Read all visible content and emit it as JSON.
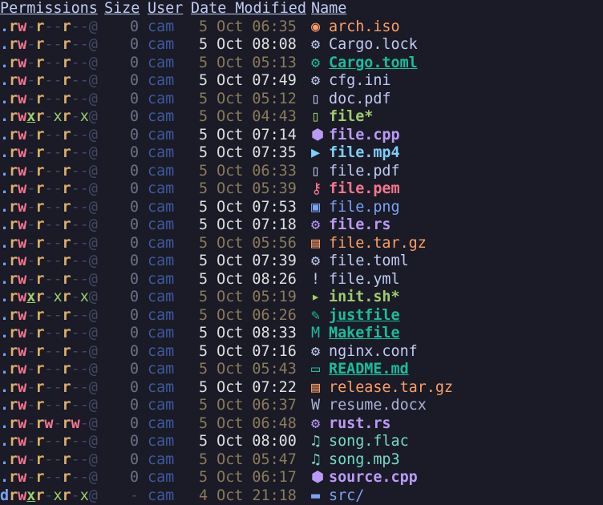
{
  "header": {
    "permissions": "Permissions",
    "size": "Size",
    "user": "User",
    "date": "Date Modified",
    "name": "Name"
  },
  "colors": {
    "background": "#1a1b26",
    "foreground": "#c0caf5",
    "perm_read": "#e0af68",
    "perm_write": "#f7768e",
    "perm_exec": "#9ece6a",
    "perm_dash": "#414868",
    "perm_dot": "#7aa2f7",
    "user": "#3d59a1",
    "date_recent": "#e0e0e0",
    "date_old": "#8c7a5a",
    "size": "#6c7086"
  },
  "files": [
    {
      "perms": ".rw-r--r--@",
      "size": "0",
      "user": "cam",
      "date": "5 Oct 06:35",
      "recent": false,
      "icon": "disc-icon",
      "glyph": "◉",
      "name": "arch.iso",
      "color": "#ff9e64",
      "bold": false,
      "underline": false
    },
    {
      "perms": ".rw-r--r--@",
      "size": "0",
      "user": "cam",
      "date": "5 Oct 08:08",
      "recent": true,
      "icon": "rust-gear-icon",
      "glyph": "⚙",
      "name": "Cargo.lock",
      "color": "#c0caf5",
      "bold": false,
      "underline": false
    },
    {
      "perms": ".rw-r--r--@",
      "size": "0",
      "user": "cam",
      "date": "5 Oct 05:13",
      "recent": false,
      "icon": "rust-gear-icon",
      "glyph": "⚙",
      "name": "Cargo.toml",
      "color": "#1abc9c",
      "bold": true,
      "underline": true
    },
    {
      "perms": ".rw-r--r--@",
      "size": "0",
      "user": "cam",
      "date": "5 Oct 07:49",
      "recent": true,
      "icon": "gear-icon",
      "glyph": "⚙",
      "name": "cfg.ini",
      "color": "#c0caf5",
      "bold": false,
      "underline": false
    },
    {
      "perms": ".rw-r--r--@",
      "size": "0",
      "user": "cam",
      "date": "5 Oct 05:12",
      "recent": false,
      "icon": "pdf-icon",
      "glyph": "▯",
      "name": "doc.pdf",
      "color": "#c0caf5",
      "bold": false,
      "underline": false
    },
    {
      "perms": ".rwxr-xr-x@",
      "size": "0",
      "user": "cam",
      "date": "5 Oct 04:43",
      "recent": false,
      "icon": "file-icon",
      "glyph": "▯",
      "name": "file*",
      "color": "#9ece6a",
      "bold": true,
      "underline": false
    },
    {
      "perms": ".rw-r--r--@",
      "size": "0",
      "user": "cam",
      "date": "5 Oct 07:14",
      "recent": true,
      "icon": "cpp-icon",
      "glyph": "⬢",
      "name": "file.cpp",
      "color": "#bb9af7",
      "bold": true,
      "underline": false
    },
    {
      "perms": ".rw-r--r--@",
      "size": "0",
      "user": "cam",
      "date": "5 Oct 07:35",
      "recent": true,
      "icon": "video-icon",
      "glyph": "▶",
      "name": "file.mp4",
      "color": "#7dcfff",
      "bold": true,
      "underline": false
    },
    {
      "perms": ".rw-r--r--@",
      "size": "0",
      "user": "cam",
      "date": "5 Oct 06:33",
      "recent": false,
      "icon": "pdf-icon",
      "glyph": "▯",
      "name": "file.pdf",
      "color": "#c0caf5",
      "bold": false,
      "underline": false
    },
    {
      "perms": ".rw-r--r--@",
      "size": "0",
      "user": "cam",
      "date": "5 Oct 05:39",
      "recent": false,
      "icon": "key-icon",
      "glyph": "⚷",
      "name": "file.pem",
      "color": "#f7768e",
      "bold": true,
      "underline": false
    },
    {
      "perms": ".rw-r--r--@",
      "size": "0",
      "user": "cam",
      "date": "5 Oct 07:53",
      "recent": true,
      "icon": "image-icon",
      "glyph": "▣",
      "name": "file.png",
      "color": "#7aa2f7",
      "bold": false,
      "underline": false
    },
    {
      "perms": ".rw-r--r--@",
      "size": "0",
      "user": "cam",
      "date": "5 Oct 07:18",
      "recent": true,
      "icon": "rust-icon",
      "glyph": "⚙",
      "name": "file.rs",
      "color": "#bb9af7",
      "bold": true,
      "underline": false
    },
    {
      "perms": ".rw-r--r--@",
      "size": "0",
      "user": "cam",
      "date": "5 Oct 05:56",
      "recent": false,
      "icon": "archive-icon",
      "glyph": "▤",
      "name": "file.tar.gz",
      "color": "#ff9e64",
      "bold": false,
      "underline": false
    },
    {
      "perms": ".rw-r--r--@",
      "size": "0",
      "user": "cam",
      "date": "5 Oct 07:39",
      "recent": true,
      "icon": "gear-icon",
      "glyph": "⚙",
      "name": "file.toml",
      "color": "#c0caf5",
      "bold": false,
      "underline": false
    },
    {
      "perms": ".rw-r--r--@",
      "size": "0",
      "user": "cam",
      "date": "5 Oct 08:26",
      "recent": true,
      "icon": "exclamation-icon",
      "glyph": "!",
      "name": "file.yml",
      "color": "#c0caf5",
      "bold": false,
      "underline": false
    },
    {
      "perms": ".rwxr-xr-x@",
      "size": "0",
      "user": "cam",
      "date": "5 Oct 05:19",
      "recent": false,
      "icon": "terminal-icon",
      "glyph": "▸",
      "name": "init.sh*",
      "color": "#9ece6a",
      "bold": true,
      "underline": false
    },
    {
      "perms": ".rw-r--r--@",
      "size": "0",
      "user": "cam",
      "date": "5 Oct 06:26",
      "recent": false,
      "icon": "wrench-icon",
      "glyph": "✎",
      "name": "justfile",
      "color": "#1abc9c",
      "bold": true,
      "underline": true
    },
    {
      "perms": ".rw-r--r--@",
      "size": "0",
      "user": "cam",
      "date": "5 Oct 08:33",
      "recent": true,
      "icon": "makefile-icon",
      "glyph": "M",
      "name": "Makefile",
      "color": "#1abc9c",
      "bold": true,
      "underline": true
    },
    {
      "perms": ".rw-r--r--@",
      "size": "0",
      "user": "cam",
      "date": "5 Oct 07:16",
      "recent": true,
      "icon": "gear-icon",
      "glyph": "⚙",
      "name": "nginx.conf",
      "color": "#c0caf5",
      "bold": false,
      "underline": false
    },
    {
      "perms": ".rw-r--r--@",
      "size": "0",
      "user": "cam",
      "date": "5 Oct 05:43",
      "recent": false,
      "icon": "markdown-icon",
      "glyph": "▭",
      "name": "README.md",
      "color": "#1abc9c",
      "bold": true,
      "underline": true
    },
    {
      "perms": ".rw-r--r--@",
      "size": "0",
      "user": "cam",
      "date": "5 Oct 07:22",
      "recent": true,
      "icon": "archive-icon",
      "glyph": "▤",
      "name": "release.tar.gz",
      "color": "#ff9e64",
      "bold": false,
      "underline": false
    },
    {
      "perms": ".rw-r--r--@",
      "size": "0",
      "user": "cam",
      "date": "5 Oct 06:37",
      "recent": false,
      "icon": "word-doc-icon",
      "glyph": "W",
      "name": "resume.docx",
      "color": "#a9b1d6",
      "bold": false,
      "underline": false
    },
    {
      "perms": ".rw-rw-rw-@",
      "size": "0",
      "user": "cam",
      "date": "5 Oct 06:48",
      "recent": false,
      "icon": "rust-icon",
      "glyph": "⚙",
      "name": "rust.rs",
      "color": "#bb9af7",
      "bold": true,
      "underline": false
    },
    {
      "perms": ".rw-r--r--@",
      "size": "0",
      "user": "cam",
      "date": "5 Oct 08:00",
      "recent": true,
      "icon": "music-icon",
      "glyph": "♫",
      "name": "song.flac",
      "color": "#73daca",
      "bold": false,
      "underline": false
    },
    {
      "perms": ".rw-r--r--@",
      "size": "0",
      "user": "cam",
      "date": "5 Oct 05:47",
      "recent": false,
      "icon": "music-icon",
      "glyph": "♫",
      "name": "song.mp3",
      "color": "#73daca",
      "bold": false,
      "underline": false
    },
    {
      "perms": ".rw-r--r--@",
      "size": "0",
      "user": "cam",
      "date": "5 Oct 06:17",
      "recent": false,
      "icon": "cpp-icon",
      "glyph": "⬢",
      "name": "source.cpp",
      "color": "#bb9af7",
      "bold": true,
      "underline": false
    },
    {
      "perms": "drwxr-xr-x@",
      "size": "-",
      "user": "cam",
      "date": "4 Oct 21:18",
      "recent": false,
      "icon": "folder-icon",
      "glyph": "▬",
      "name": "src/",
      "color": "#7aa2f7",
      "bold": false,
      "underline": false
    }
  ]
}
